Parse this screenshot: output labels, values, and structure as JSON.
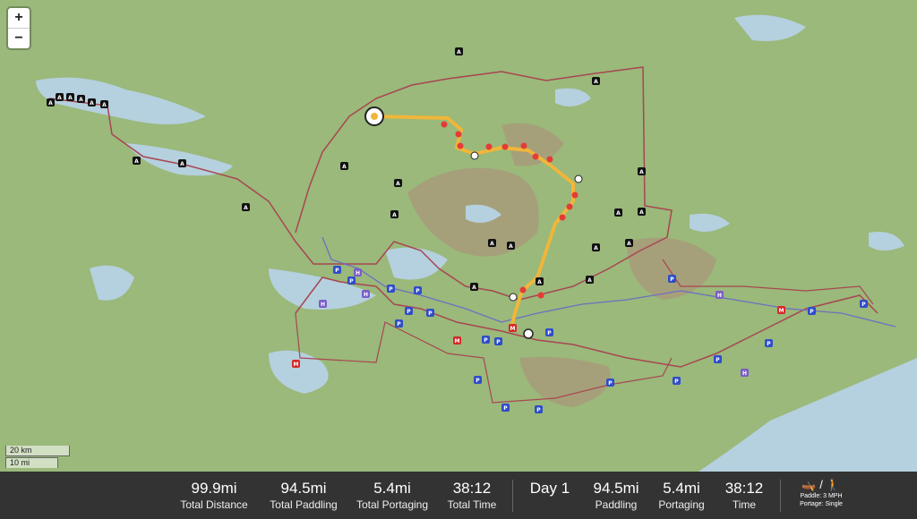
{
  "map": {
    "zoom_in": "+",
    "zoom_out": "−",
    "scale_km": "20 km",
    "scale_mi": "10 mi",
    "colors": {
      "land": "#9ab97a",
      "water": "#b5d0de",
      "route": "#f0b63a",
      "boundary": "#a84652",
      "portage": "#e53b36",
      "trail": "#6d6fc2"
    }
  },
  "stats": {
    "total": [
      {
        "value": "99.9mi",
        "label": "Total Distance"
      },
      {
        "value": "94.5mi",
        "label": "Total Paddling"
      },
      {
        "value": "5.4mi",
        "label": "Total Portaging"
      },
      {
        "value": "38:12",
        "label": "Total Time"
      }
    ],
    "day": {
      "value": "Day 1"
    },
    "daily": [
      {
        "value": "94.5mi",
        "label": "Paddling"
      },
      {
        "value": "5.4mi",
        "label": "Portaging"
      },
      {
        "value": "38:12",
        "label": "Time"
      }
    ],
    "settings": {
      "icons": "🛶 / 🚶",
      "paddle": "Paddle: 3 MPH",
      "portage": "Portage: Single"
    }
  }
}
